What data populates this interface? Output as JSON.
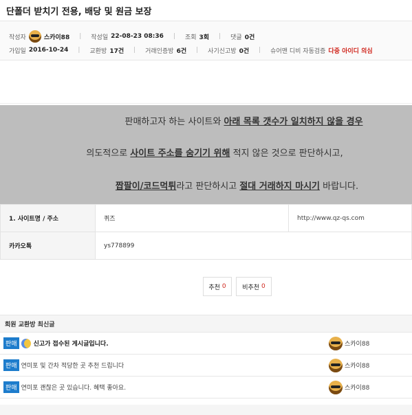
{
  "post": {
    "title": "단폴더 받치기 전용, 배당 및 원금 보장"
  },
  "meta": {
    "author_label": "작성자",
    "author": "스카이88",
    "date_label": "작성일",
    "date": "22-08-23 08:36",
    "views_label": "조회",
    "views": "3회",
    "comments_label": "댓글",
    "comments": "0건",
    "joined_label": "가입일",
    "joined": "2016-10-24",
    "exchange_label": "교환방",
    "exchange": "17건",
    "trade_proof_label": "거래인증방",
    "trade_proof": "6건",
    "fraud_label": "사기신고방",
    "fraud": "0건",
    "check_label": "슈어맨 디비 자동검증",
    "check_result": "다중 아이디 의심"
  },
  "notice": {
    "l1_a": "판매하고자 하는 사이트와 ",
    "l1_b": "아래 목록 갯수가 일치하지 않을 경우",
    "l2_a": "의도적으로 ",
    "l2_b": "사이트 주소를 숨기기 위해",
    "l2_c": " 적지 않은 것으로 판단하시고,",
    "l3_a": "짭팔이/코드먹튀",
    "l3_b": "라고 판단하시고 ",
    "l3_c": "절대 거래하지 마시기",
    "l3_d": " 바랍니다."
  },
  "info": {
    "site_label": "1. 사이트명 / 주소",
    "site_name": "퀴즈",
    "site_url": "http://www.qz-qs.com",
    "kakao_label": "카카오톡",
    "kakao_id": "ys778899"
  },
  "vote": {
    "up_label": "추천",
    "up_count": "0",
    "down_label": "비추천",
    "down_count": "0"
  },
  "recent": {
    "heading": "회원 교환방 최신글",
    "items": [
      {
        "badge": "판매",
        "title": "신고가 접수된 게시글입니다.",
        "author": "스카이88"
      },
      {
        "badge": "판매",
        "title": "연미포 및 간차 적당한 곳 추천 드립니다",
        "author": "스카이88"
      },
      {
        "badge": "판매",
        "title": "연미포 괜찮은 곳 있습니다. 혜택 좋아요.",
        "author": "스카이88"
      }
    ]
  },
  "colors": {
    "accent_red": "#d0261d",
    "badge_blue": "#1d7ccc",
    "notice_bg": "#bdbdbd"
  }
}
